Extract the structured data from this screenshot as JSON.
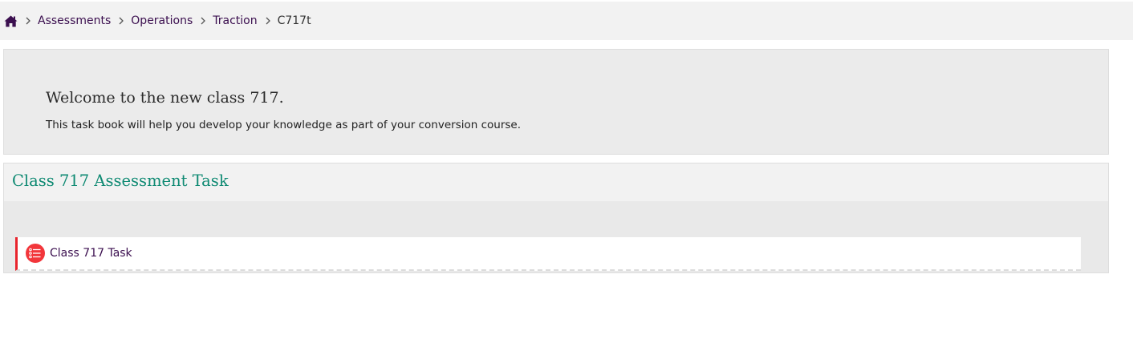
{
  "breadcrumb": {
    "home_icon": "home-icon",
    "separator_icon": "chevron-right-icon",
    "items": [
      {
        "label": "Assessments"
      },
      {
        "label": "Operations"
      },
      {
        "label": "Traction"
      }
    ],
    "current": "C717t"
  },
  "welcome": {
    "title": "Welcome to the new class 717.",
    "text": "This task book will help you develop your knowledge as part of your conversion course."
  },
  "section": {
    "title": "Class 717 Assessment Task",
    "activity": {
      "icon": "checklist-icon",
      "label": "Class 717 Task"
    }
  },
  "colors": {
    "link": "#3b0f4f",
    "section_title": "#0f8a73",
    "activity_accent": "#e8242d",
    "panel_bg": "#ebebeb",
    "breadcrumb_bg": "#f2f2f2"
  }
}
